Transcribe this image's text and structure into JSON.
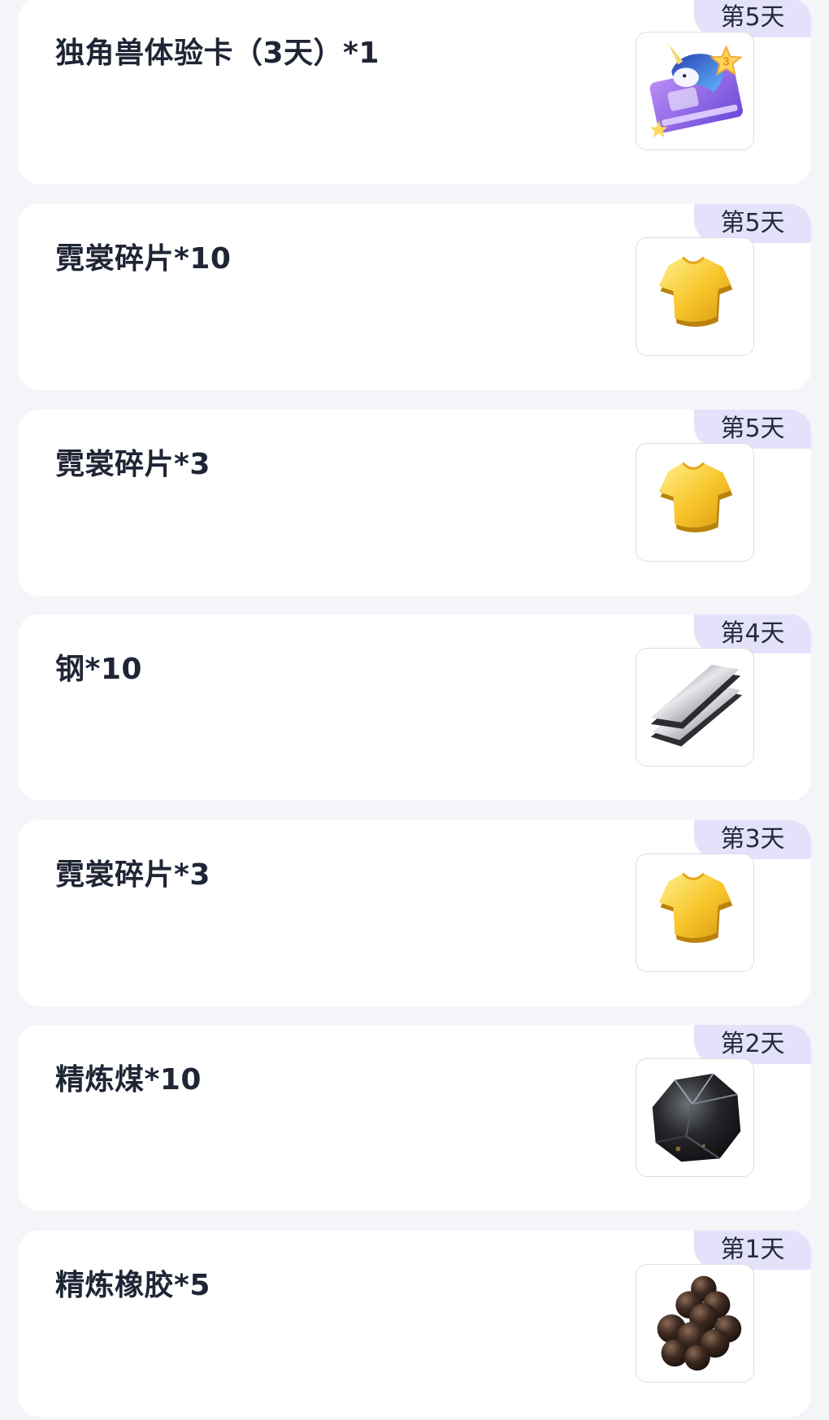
{
  "rewards": [
    {
      "title": "独角兽体验卡（3天）*1",
      "day": "第5天",
      "icon": "unicorn-card-icon"
    },
    {
      "title": "霓裳碎片*10",
      "day": "第5天",
      "icon": "gold-shirt-icon"
    },
    {
      "title": "霓裳碎片*3",
      "day": "第5天",
      "icon": "gold-shirt-icon"
    },
    {
      "title": "钢*10",
      "day": "第4天",
      "icon": "steel-plates-icon"
    },
    {
      "title": "霓裳碎片*3",
      "day": "第3天",
      "icon": "gold-shirt-icon"
    },
    {
      "title": "精炼煤*10",
      "day": "第2天",
      "icon": "coal-icon"
    },
    {
      "title": "精炼橡胶*5",
      "day": "第1天",
      "icon": "rubber-icon"
    }
  ],
  "colors": {
    "page_background": "#f3f5f9",
    "card_background": "#ffffff",
    "badge_background": "#e4e2fb",
    "title_text": "#1f2535"
  }
}
